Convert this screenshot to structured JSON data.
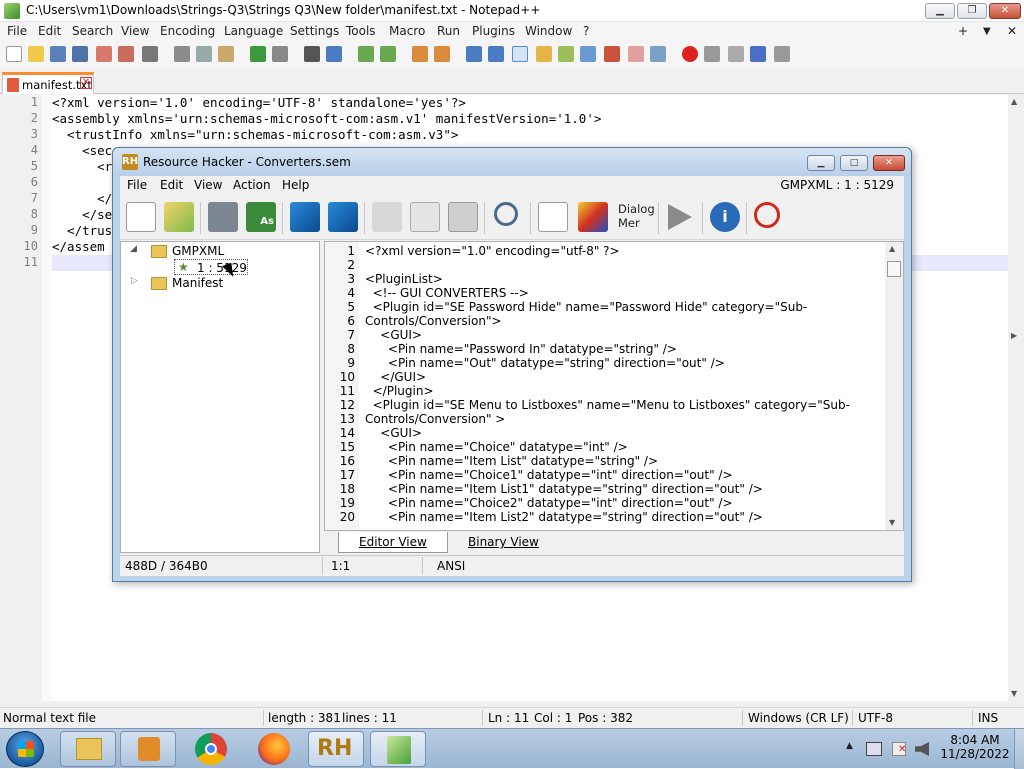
{
  "npp": {
    "title": "C:\\Users\\vm1\\Downloads\\Strings-Q3\\Strings Q3\\New folder\\manifest.txt - Notepad++",
    "window_buttons": {
      "minimize": "▁",
      "maximize": "❐",
      "close": "✕"
    },
    "menu": [
      "File",
      "Edit",
      "Search",
      "View",
      "Encoding",
      "Language",
      "Settings",
      "Tools",
      "Macro",
      "Run",
      "Plugins",
      "Window",
      "?"
    ],
    "menu_right": {
      "plus": "+",
      "down": "▼",
      "close": "✕"
    },
    "tab_label": "manifest.txt",
    "tab_close": "✕",
    "line_numbers": [
      "1",
      "2",
      "3",
      "4",
      "5",
      "6",
      "7",
      "8",
      "9",
      "10",
      "11"
    ],
    "lines": [
      "<?xml version='1.0' encoding='UTF-8' standalone='yes'?>",
      "<assembly xmlns='urn:schemas-microsoft-com:asm.v1' manifestVersion='1.0'>",
      "  <trustInfo xmlns=\"urn:schemas-microsoft-com:asm.v3\">",
      "    <sec",
      "      <r",
      "",
      "      </",
      "    </se",
      "  </trus",
      "</assem",
      ""
    ],
    "status": {
      "file_type": "Normal text file",
      "length": "length : 381",
      "lines": "lines : 11",
      "ln": "Ln : 11",
      "col": "Col : 1",
      "pos": "Pos : 382",
      "eol": "Windows (CR LF)",
      "encoding": "UTF-8",
      "mode": "INS"
    }
  },
  "rh": {
    "title": "Resource Hacker - Converters.sem",
    "icon_text": "RH",
    "window_buttons": {
      "minimize": "▁",
      "maximize": "□",
      "close": "✕"
    },
    "menu": [
      "File",
      "Edit",
      "View",
      "Action",
      "Help"
    ],
    "resource_info": "GMPXML : 1 : 5129",
    "toolbar_dialog_label_1": "Dialog",
    "toolbar_dialog_label_2": "Mer",
    "tree": {
      "root": "GMPXML",
      "child": "1 : 5129",
      "manifest": "Manifest"
    },
    "code_line_numbers": [
      "1",
      "2",
      "3",
      "4",
      "5",
      "6",
      "7",
      "8",
      "9",
      "10",
      "11",
      "12",
      "13",
      "14",
      "15",
      "16",
      "17",
      "18",
      "19",
      "20"
    ],
    "code_lines": [
      "<?xml version=\"1.0\" encoding=\"utf-8\" ?>",
      "",
      "<PluginList>",
      "  <!-- GUI CONVERTERS -->",
      "  <Plugin id=\"SE Password Hide\" name=\"Password Hide\" category=\"Sub-",
      "Controls/Conversion\">",
      "    <GUI>",
      "      <Pin name=\"Password In\" datatype=\"string\" />",
      "      <Pin name=\"Out\" datatype=\"string\" direction=\"out\" />",
      "    </GUI>",
      "  </Plugin>",
      "  <Plugin id=\"SE Menu to Listboxes\" name=\"Menu to Listboxes\" category=\"Sub-",
      "Controls/Conversion\" >",
      "    <GUI>",
      "      <Pin name=\"Choice\" datatype=\"int\" />",
      "      <Pin name=\"Item List\" datatype=\"string\" />",
      "      <Pin name=\"Choice1\" datatype=\"int\" direction=\"out\" />",
      "      <Pin name=\"Item List1\" datatype=\"string\" direction=\"out\" />",
      "      <Pin name=\"Choice2\" datatype=\"int\" direction=\"out\" />",
      "      <Pin name=\"Item List2\" datatype=\"string\" direction=\"out\" />"
    ],
    "tabs": {
      "editor": "Editor View",
      "binary": "Binary View"
    },
    "status": {
      "offsets": "488D / 364B0",
      "pos": "1:1",
      "encoding": "ANSI"
    }
  },
  "taskbar": {
    "rh_label": "RH",
    "time": "8:04 AM",
    "date": "11/28/2022",
    "tray_arrow": "▲"
  }
}
